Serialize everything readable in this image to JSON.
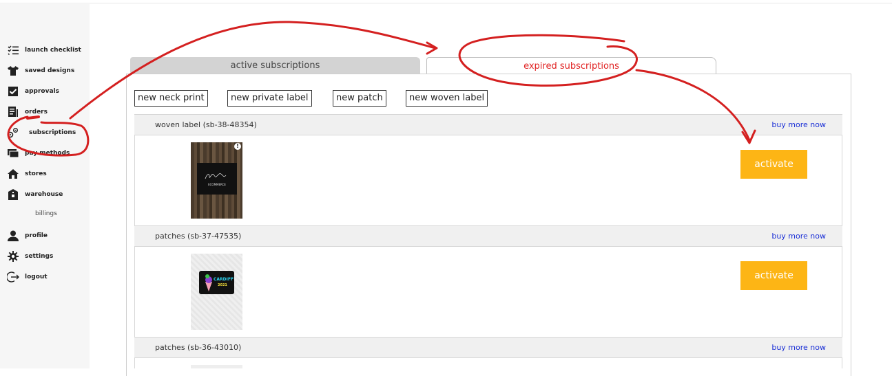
{
  "sidebar": {
    "items": [
      {
        "label": "launch checklist",
        "icon": "checklist-icon"
      },
      {
        "label": "saved designs",
        "icon": "tshirt-icon"
      },
      {
        "label": "approvals",
        "icon": "checkbox-icon"
      },
      {
        "label": "orders",
        "icon": "document-icon"
      },
      {
        "label": "subscriptions",
        "icon": "gears-icon"
      },
      {
        "label": "pay methods",
        "icon": "wallet-icon"
      },
      {
        "label": "stores",
        "icon": "home-icon"
      },
      {
        "label": "warehouse",
        "icon": "warehouse-icon"
      },
      {
        "label": "billings",
        "icon": ""
      },
      {
        "label": "profile",
        "icon": "person-icon"
      },
      {
        "label": "settings",
        "icon": "gear-icon"
      },
      {
        "label": "logout",
        "icon": "logout-icon"
      }
    ]
  },
  "tabs": {
    "active": "active subscriptions",
    "expired": "expired subscriptions"
  },
  "actions": {
    "neck_print": "new neck print",
    "private_label": "new private label",
    "patch": "new patch",
    "woven_label": "new woven label"
  },
  "subscriptions": [
    {
      "name": "woven label (sb-38-48354)",
      "buy": "buy more now",
      "button": "activate",
      "thumb_text": "ECOMMERCE"
    },
    {
      "name": "patches (sb-37-47535)",
      "buy": "buy more now",
      "button": "activate",
      "thumb_text": "CARDIFF",
      "thumb_sub": "2021"
    },
    {
      "name": "patches (sb-36-43010)",
      "buy": "buy more now"
    }
  ],
  "colors": {
    "accent": "#fdb515",
    "link": "#1a2fd6",
    "annotation": "#e02020"
  }
}
